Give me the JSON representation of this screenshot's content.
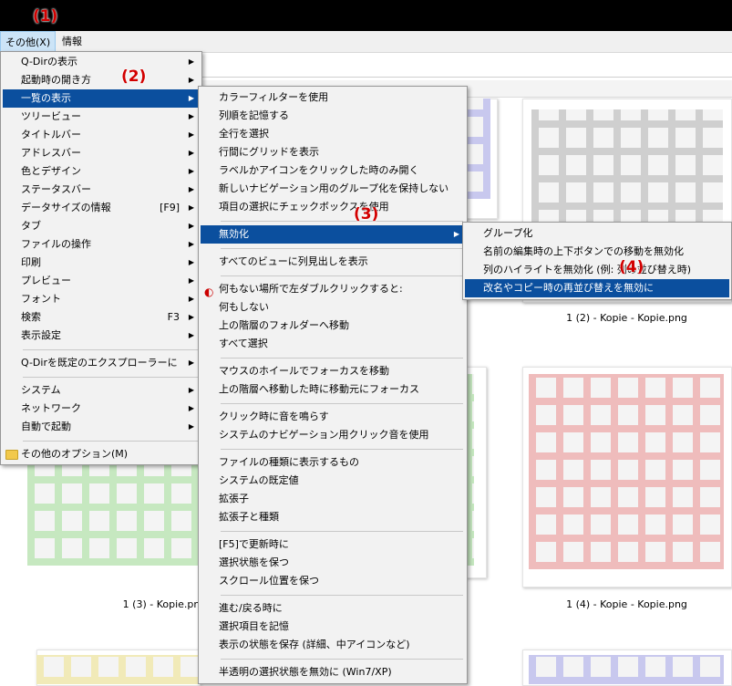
{
  "menubar": {
    "sonota": "その他(X)",
    "info": "情報"
  },
  "annotations": [
    "(1)",
    "(2)",
    "(3)",
    "(4)"
  ],
  "main_menu": [
    {
      "label": "Q-Dirの表示",
      "sub": true
    },
    {
      "label": "起動時の開き方",
      "sub": true
    },
    {
      "label": "一覧の表示",
      "sub": true,
      "hl": true
    },
    {
      "label": "ツリービュー",
      "sub": true
    },
    {
      "label": "タイトルバー",
      "sub": true
    },
    {
      "label": "アドレスバー",
      "sub": true
    },
    {
      "label": "色とデザイン",
      "sub": true
    },
    {
      "label": "ステータスバー",
      "sub": true
    },
    {
      "label": "データサイズの情報",
      "key": "[F9]",
      "sub": true
    },
    {
      "label": "タブ",
      "sub": true
    },
    {
      "label": "ファイルの操作",
      "sub": true
    },
    {
      "label": "印刷",
      "sub": true
    },
    {
      "label": "プレビュー",
      "sub": true
    },
    {
      "label": "フォント",
      "sub": true
    },
    {
      "label": "検索",
      "key": "F3",
      "sub": true
    },
    {
      "label": "表示設定",
      "sub": true
    },
    {
      "sep": true
    },
    {
      "label": "Q-Dirを既定のエクスプローラーに",
      "sub": true
    },
    {
      "sep": true
    },
    {
      "label": "システム",
      "sub": true
    },
    {
      "label": "ネットワーク",
      "sub": true
    },
    {
      "label": "自動で起動",
      "sub": true
    },
    {
      "sep": true
    },
    {
      "label": "その他のオプション(M)",
      "folder": true
    }
  ],
  "list_menu": [
    {
      "label": "カラーフィルターを使用"
    },
    {
      "label": "列順を記憶する"
    },
    {
      "label": "全行を選択"
    },
    {
      "label": "行間にグリッドを表示"
    },
    {
      "label": "ラベルかアイコンをクリックした時のみ開く"
    },
    {
      "label": "新しいナビゲーション用のグループ化を保持しない"
    },
    {
      "label": "項目の選択にチェックボックスを使用"
    },
    {
      "sep": true
    },
    {
      "label": "無効化",
      "sub": true,
      "hl": true
    },
    {
      "sep": true
    },
    {
      "label": "すべてのビューに列見出しを表示"
    },
    {
      "sep": true
    },
    {
      "label": "何もない場所で左ダブルクリックすると:",
      "icon": "dbl"
    },
    {
      "label": "何もしない"
    },
    {
      "label": "上の階層のフォルダーへ移動"
    },
    {
      "label": "すべて選択"
    },
    {
      "sep": true
    },
    {
      "label": "マウスのホイールでフォーカスを移動"
    },
    {
      "label": "上の階層へ移動した時に移動元にフォーカス"
    },
    {
      "sep": true
    },
    {
      "label": "クリック時に音を鳴らす"
    },
    {
      "label": "システムのナビゲーション用クリック音を使用"
    },
    {
      "sep": true
    },
    {
      "label": "ファイルの種類に表示するもの"
    },
    {
      "label": "システムの既定値"
    },
    {
      "label": "拡張子"
    },
    {
      "label": "拡張子と種類"
    },
    {
      "sep": true
    },
    {
      "label": "[F5]で更新時に"
    },
    {
      "label": "選択状態を保つ"
    },
    {
      "label": "スクロール位置を保つ"
    },
    {
      "sep": true
    },
    {
      "label": "進む/戻る時に"
    },
    {
      "label": "選択項目を記憶"
    },
    {
      "label": "表示の状態を保存 (詳細、中アイコンなど)"
    },
    {
      "sep": true
    },
    {
      "label": "半透明の選択状態を無効に (Win7/XP)"
    }
  ],
  "disable_menu": [
    {
      "label": "グループ化"
    },
    {
      "label": "名前の編集時の上下ボタンでの移動を無効化"
    },
    {
      "label": "列のハイライトを無効化 (例: 列の並び替え時)"
    },
    {
      "label": "改名やコピー時の再並び替えを無効に",
      "hl": true
    }
  ],
  "thumbnails": [
    {
      "label": "",
      "color": "#c8c8ee"
    },
    {
      "label": "",
      "color": "#cfcfcf"
    },
    {
      "label": "1 (2) - Kopie - Kopie.png",
      "color": ""
    },
    {
      "label": "",
      "color": "#c6e8c0"
    },
    {
      "label": "",
      "color": "#efbcbc"
    },
    {
      "label": "1 (3) - Kopie.png",
      "color": ""
    },
    {
      "label": "1 (4) - Kopie - Kopie.png",
      "color": ""
    },
    {
      "label": "",
      "color": "#f1eab8"
    },
    {
      "label": "",
      "color": "#c8c8ee"
    }
  ]
}
